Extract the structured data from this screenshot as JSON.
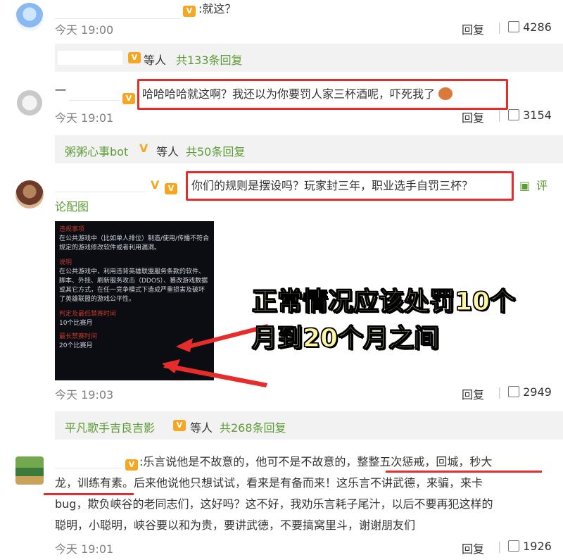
{
  "comments": [
    {
      "text": ":就这？",
      "time": "今天 19:00",
      "reply": "回复",
      "likes": "4286"
    },
    {
      "text": "哈哈哈哈就这啊？我还以为你要罚人家三杯酒呢，吓死我了",
      "time": "今天 19:01",
      "reply": "回复",
      "likes": "3154",
      "prefix": "一"
    },
    {
      "text": "你们的规则是摆设吗？玩家封三年，职业选手自罚三杯？",
      "suffix": "评论配图",
      "suffix_a": "评",
      "suffix_b": "论配图",
      "time": "今天 19:03",
      "reply": "回复",
      "likes": "2949"
    },
    {
      "line1": ":乐言说他是不故意的，他可不是不故意的，整整五次惩戒，回城，秒大",
      "line2": "龙，训练有素。后来他说他只想试试，看来是有备而来！这乐言不讲武德，来骗，来卡",
      "line3": "bug，欺负峡谷的老同志们，这好吗？这不好，我劝乐言耗子尾汁，以后不要再犯这样的",
      "line4": "聪明，小聪明，峡谷要以和为贵，要讲武德，不要搞窝里斗，谢谢朋友们",
      "time": "今天 19:01",
      "reply": "回复",
      "likes": "1926"
    }
  ],
  "reply_summaries": [
    {
      "name": "",
      "middle": "等人",
      "count": "共133条回复"
    },
    {
      "name": "粥粥心事bot",
      "middle": "等人",
      "count": "共50条回复"
    },
    {
      "name": "平凡歌手吉良吉影",
      "middle": "等人",
      "count": "共268条回复"
    }
  ],
  "post_image": {
    "sec1_title": "违规事项",
    "sec1_body": "在公共游戏中（比如单人排位）制造/使用/传播不符合规定的游戏修改软件或者利用漏洞。",
    "sec2_title": "说明",
    "sec2_body": "在公共游戏中，利用违背英雄联盟服务条款的软件、脚本、外挂、刷新服务攻击（DDOS）、篡改游戏数据或其它方式，在任一竞争模式下造成严重损害及破坏了英雄联盟的游戏公平性。",
    "sec3_title": "判定及最低禁赛时间",
    "sec3_value": "10个比赛月",
    "sec4_title": "最长禁赛时间",
    "sec4_value": "20个比赛月"
  },
  "overlay_text": {
    "line1": "正常情况应该处罚10个",
    "line2": "月到20个月之间"
  },
  "colors": {
    "highlight_box": "#e82b2b",
    "overlay_text": "#fff7a0",
    "reply_green": "#5b9b34",
    "vip_badge": "#f5a623"
  }
}
